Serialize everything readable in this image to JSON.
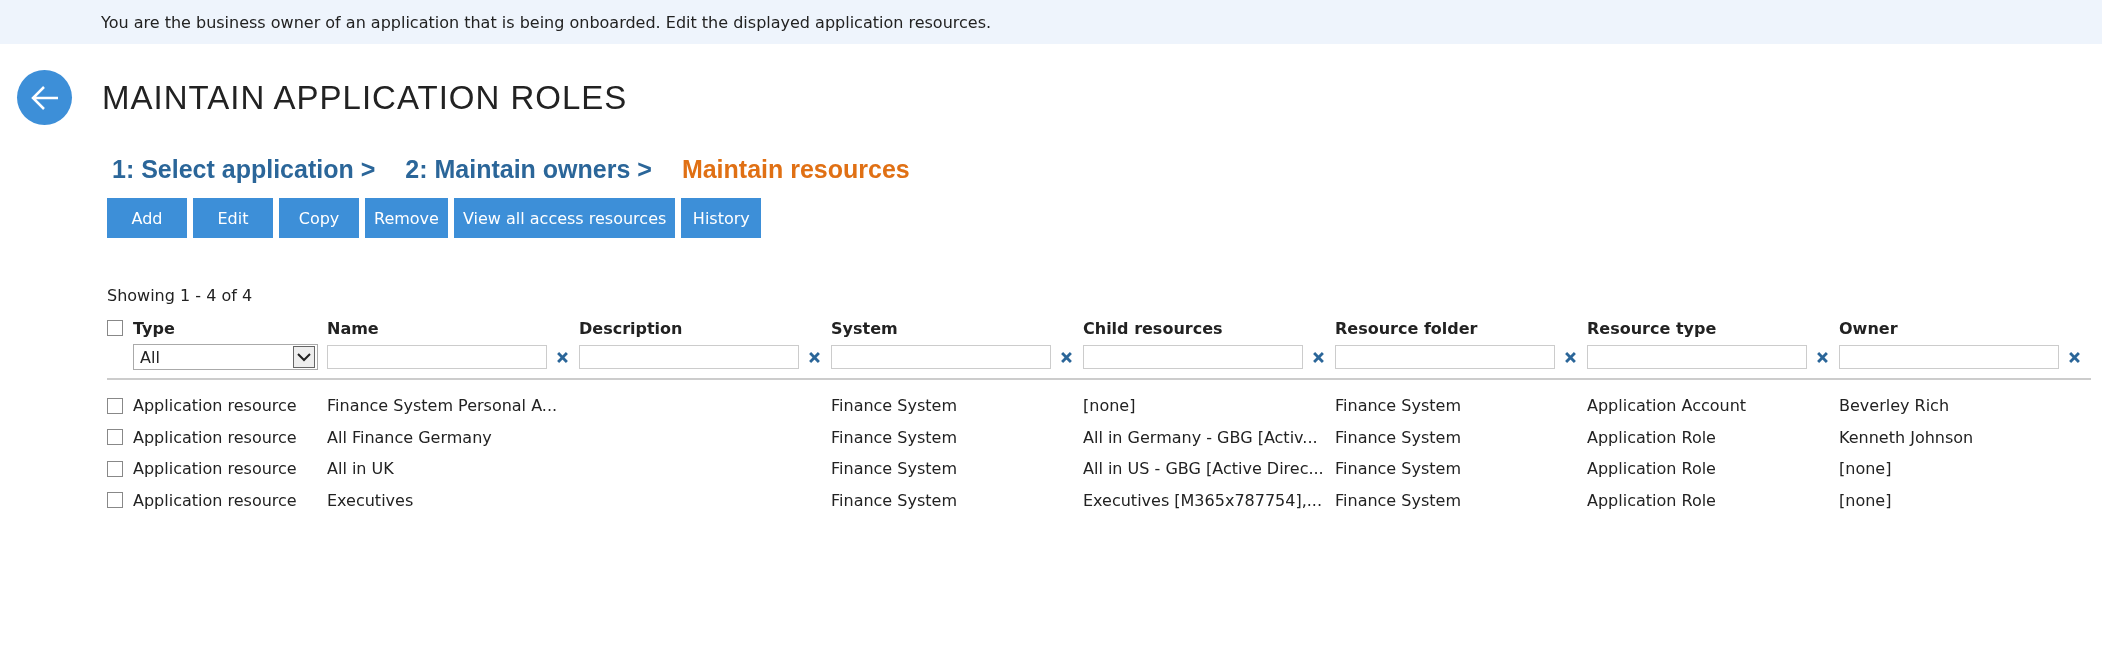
{
  "banner": {
    "text": "You are the business owner of an application that is being onboarded. Edit the displayed application resources."
  },
  "page_title": "MAINTAIN APPLICATION ROLES",
  "steps": [
    {
      "label": "1: Select application >",
      "selected": false
    },
    {
      "label": "2: Maintain owners >",
      "selected": false
    },
    {
      "label": "Maintain resources",
      "selected": true
    }
  ],
  "toolbar": [
    "Add",
    "Edit",
    "Copy",
    "Remove",
    "View all access resources",
    "History"
  ],
  "table": {
    "summary": "Showing 1 - 4 of 4",
    "select_all": {
      "checked": false
    },
    "columns": [
      {
        "label": "Type",
        "filter": {
          "kind": "select",
          "value": "All"
        }
      },
      {
        "label": "Name",
        "filter": {
          "kind": "text"
        }
      },
      {
        "label": "Description",
        "filter": {
          "kind": "text"
        }
      },
      {
        "label": "System",
        "filter": {
          "kind": "text"
        }
      },
      {
        "label": "Child resources",
        "filter": {
          "kind": "text"
        }
      },
      {
        "label": "Resource folder",
        "filter": {
          "kind": "text"
        }
      },
      {
        "label": "Resource type",
        "filter": {
          "kind": "text"
        }
      },
      {
        "label": "Owner",
        "filter": {
          "kind": "text"
        }
      }
    ],
    "rows": [
      {
        "checked": false,
        "cells": [
          "Application resource",
          "Finance System Personal A...",
          "",
          "Finance System",
          "[none]",
          "Finance System",
          "Application Account",
          "Beverley Rich"
        ]
      },
      {
        "checked": false,
        "cells": [
          "Application resource",
          "All Finance Germany",
          "",
          "Finance System",
          "All in Germany - GBG [Activ...",
          "Finance System",
          "Application Role",
          "Kenneth Johnson"
        ]
      },
      {
        "checked": false,
        "cells": [
          "Application resource",
          "All in UK",
          "",
          "Finance System",
          "All in US - GBG [Active Direc...",
          "Finance System",
          "Application Role",
          "[none]"
        ]
      },
      {
        "checked": false,
        "cells": [
          "Application resource",
          "Executives",
          "",
          "Finance System",
          "Executives [M365x787754],...",
          "Finance System",
          "Application Role",
          "[none]"
        ]
      }
    ]
  }
}
